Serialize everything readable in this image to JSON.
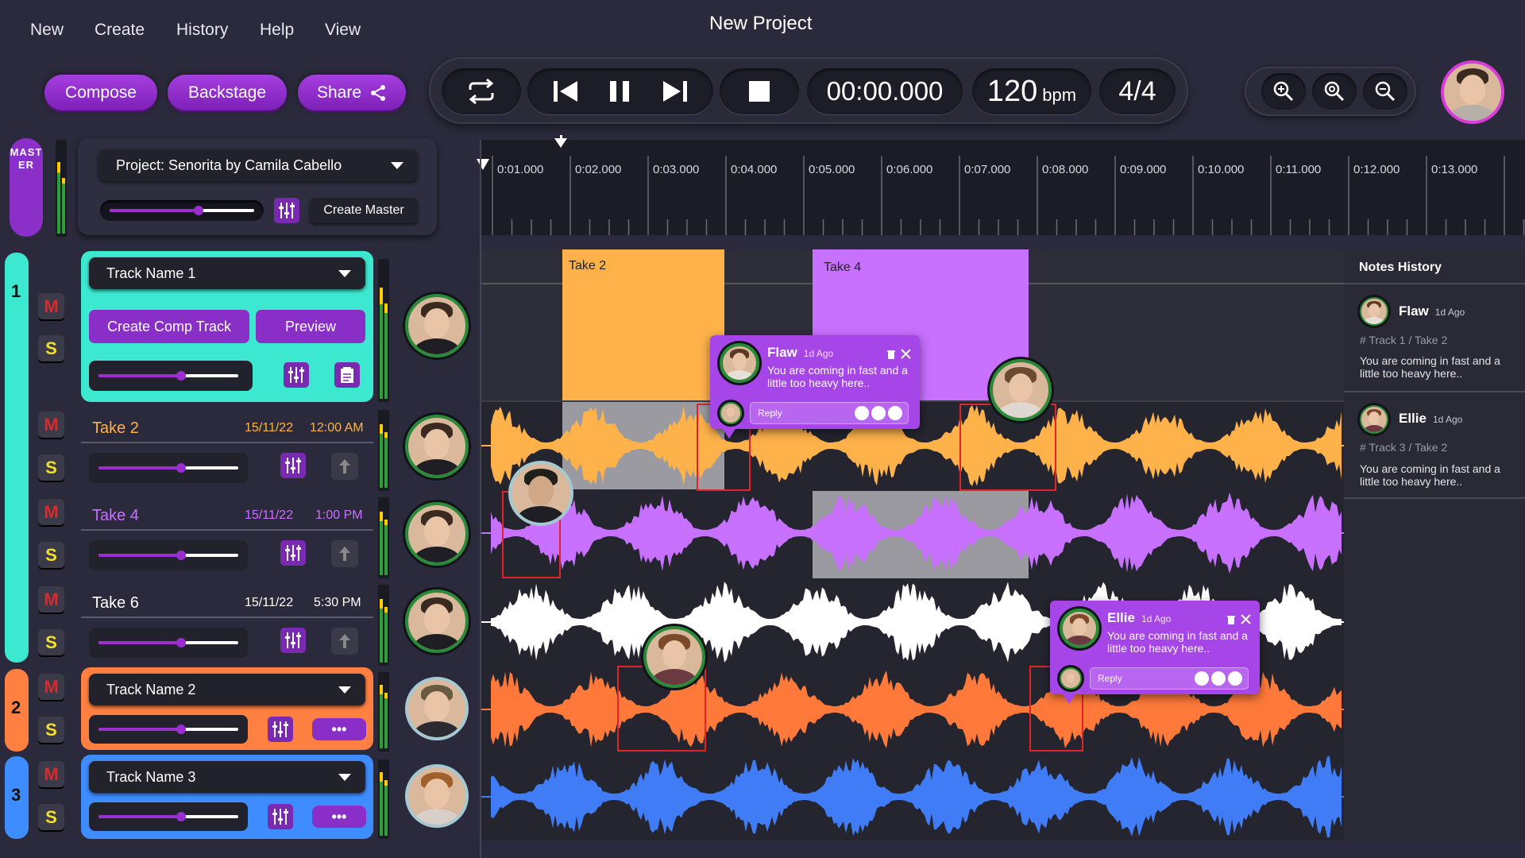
{
  "menu": {
    "items": [
      "New",
      "Create",
      "History",
      "Help",
      "View"
    ]
  },
  "title": "New Project",
  "buttons": {
    "compose": "Compose",
    "backstage": "Backstage",
    "share": "Share"
  },
  "transport": {
    "time": "00:00.000",
    "bpm": "120",
    "bpm_unit": "bpm",
    "signature": "4/4"
  },
  "master": {
    "label": "MASTER",
    "project_select": "Project: Senorita by Camila Cabello",
    "volume": 0.62,
    "create_master": "Create Master"
  },
  "timeline": {
    "ticks": [
      "0:01.000",
      "0:02.000",
      "0:03.000",
      "0:04.000",
      "0:05.000",
      "0:06.000",
      "0:07.000",
      "0:08.000",
      "0:09.000",
      "0:10.000",
      "0:11.000",
      "0:12.000",
      "0:13.000"
    ]
  },
  "tracks": {
    "group1": {
      "number": "1",
      "name": "Track Name 1",
      "create_comp": "Create Comp Track",
      "preview": "Preview",
      "volume": 0.58
    },
    "take2": {
      "name": "Take 2",
      "date": "15/11/22",
      "time": "12:00 AM",
      "volume": 0.58
    },
    "take4": {
      "name": "Take 4",
      "date": "15/11/22",
      "time": "1:00 PM",
      "volume": 0.58
    },
    "take6": {
      "name": "Take 6",
      "date": "15/11/22",
      "time": "5:30 PM",
      "volume": 0.58
    },
    "group2": {
      "number": "2",
      "name": "Track Name 2",
      "volume": 0.58
    },
    "group3": {
      "number": "3",
      "name": "Track Name 3",
      "volume": 0.58
    },
    "mute": "M",
    "solo": "S",
    "more": "•••"
  },
  "clips": {
    "clip1": "Take 2",
    "clip2": "Take 4"
  },
  "comments": {
    "c1": {
      "name": "Flaw",
      "ago": "1d Ago",
      "text": "You are coming in fast and a little too heavy here..",
      "reply": "Reply"
    },
    "c2": {
      "name": "Ellie",
      "ago": "1d Ago",
      "text": "You are coming in fast and a little too heavy here..",
      "reply": "Reply"
    }
  },
  "notes": {
    "title": "Notes History",
    "items": [
      {
        "name": "Flaw",
        "ago": "1d Ago",
        "ref": "# Track 1 / Take 2",
        "text": "You are coming in fast and a little too heavy here.."
      },
      {
        "name": "Ellie",
        "ago": "1d Ago",
        "ref": "# Track 3 / Take 2",
        "text": "You are coming in fast and a little too heavy here.."
      }
    ]
  },
  "colors": {
    "accent": "#9a2ed0",
    "cyan": "#3de8d0",
    "orange": "#ff8040",
    "blue": "#3f8cff",
    "take2_wave": "#ffb24a",
    "take4_wave": "#c870ff",
    "orange_wave": "#ff7a3a",
    "blue_wave": "#3f7cf5"
  }
}
